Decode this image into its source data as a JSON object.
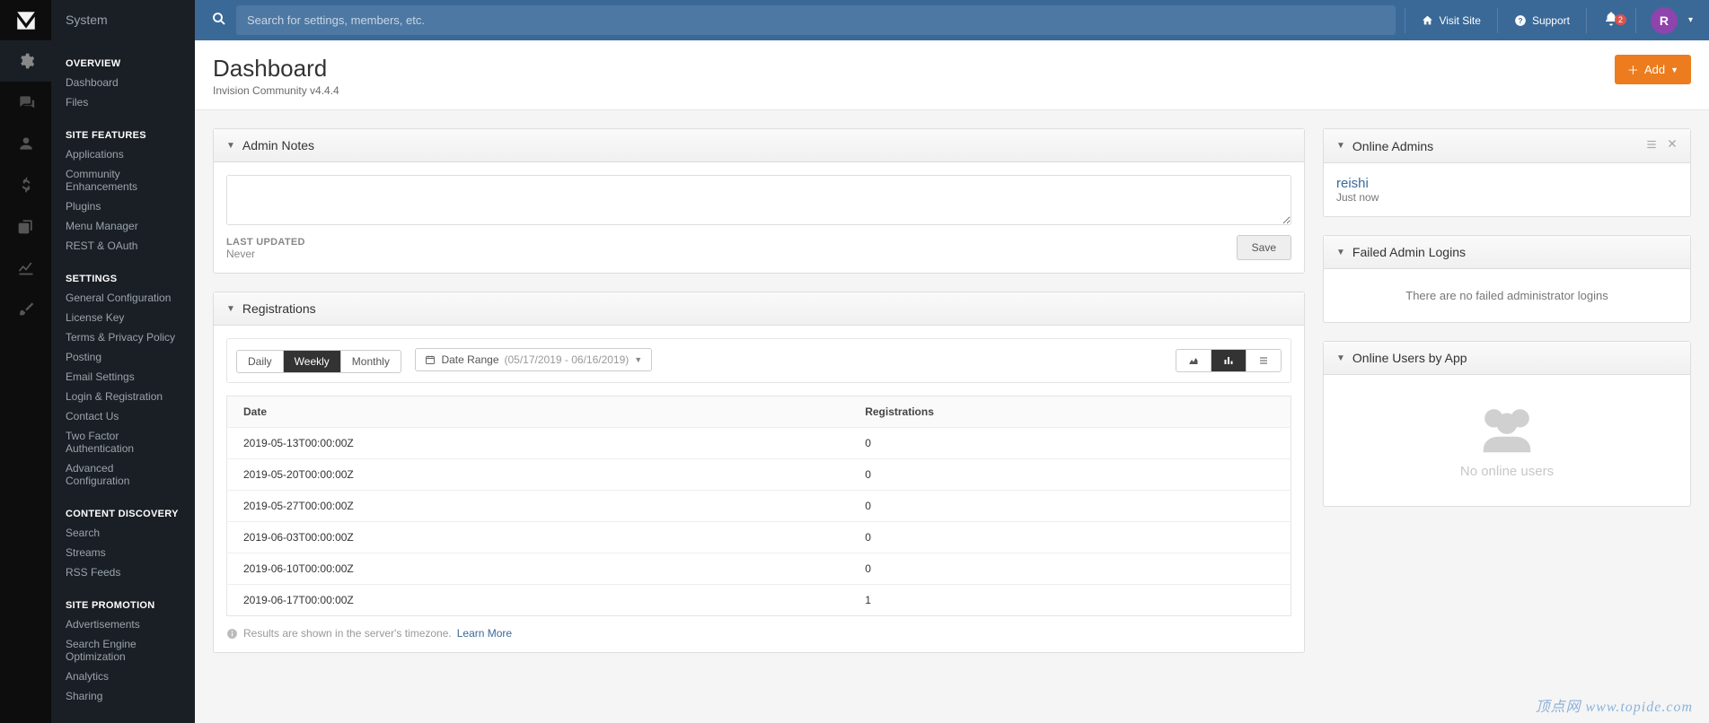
{
  "app_name": "System",
  "search": {
    "placeholder": "Search for settings, members, etc."
  },
  "topbar": {
    "visit_site": "Visit Site",
    "support": "Support",
    "notif_count": "2",
    "avatar_letter": "R"
  },
  "rail": [
    {
      "icon": "gear-icon"
    },
    {
      "icon": "comments-icon"
    },
    {
      "icon": "user-icon"
    },
    {
      "icon": "dollar-icon"
    },
    {
      "icon": "copy-icon"
    },
    {
      "icon": "chart-icon"
    },
    {
      "icon": "brush-icon"
    }
  ],
  "sidebar": [
    {
      "heading": "OVERVIEW",
      "items": [
        "Dashboard",
        "Files"
      ]
    },
    {
      "heading": "SITE FEATURES",
      "items": [
        "Applications",
        "Community Enhancements",
        "Plugins",
        "Menu Manager",
        "REST & OAuth"
      ]
    },
    {
      "heading": "SETTINGS",
      "items": [
        "General Configuration",
        "License Key",
        "Terms & Privacy Policy",
        "Posting",
        "Email Settings",
        "Login & Registration",
        "Contact Us",
        "Two Factor Authentication",
        "Advanced Configuration"
      ]
    },
    {
      "heading": "CONTENT DISCOVERY",
      "items": [
        "Search",
        "Streams",
        "RSS Feeds"
      ]
    },
    {
      "heading": "SITE PROMOTION",
      "items": [
        "Advertisements",
        "Search Engine Optimization",
        "Analytics",
        "Sharing"
      ]
    }
  ],
  "page": {
    "title": "Dashboard",
    "subtitle": "Invision Community v4.4.4",
    "add_btn": "Add"
  },
  "admin_notes": {
    "panel_title": "Admin Notes",
    "last_updated_label": "LAST UPDATED",
    "last_updated_value": "Never",
    "save_label": "Save"
  },
  "registrations": {
    "panel_title": "Registrations",
    "periods": {
      "daily": "Daily",
      "weekly": "Weekly",
      "monthly": "Monthly"
    },
    "date_range_label": "Date Range",
    "date_range_value": "(05/17/2019 - 06/16/2019)",
    "columns": {
      "date": "Date",
      "count": "Registrations"
    },
    "rows": [
      {
        "date": "2019-05-13T00:00:00Z",
        "count": "0"
      },
      {
        "date": "2019-05-20T00:00:00Z",
        "count": "0"
      },
      {
        "date": "2019-05-27T00:00:00Z",
        "count": "0"
      },
      {
        "date": "2019-06-03T00:00:00Z",
        "count": "0"
      },
      {
        "date": "2019-06-10T00:00:00Z",
        "count": "0"
      },
      {
        "date": "2019-06-17T00:00:00Z",
        "count": "1"
      }
    ],
    "footer_note": "Results are shown in the server's timezone.",
    "learn_more": "Learn More"
  },
  "online_admins": {
    "panel_title": "Online Admins",
    "entries": [
      {
        "name": "reishi",
        "time": "Just now"
      }
    ]
  },
  "failed_logins": {
    "panel_title": "Failed Admin Logins",
    "message": "There are no failed administrator logins"
  },
  "online_by_app": {
    "panel_title": "Online Users by App",
    "message": "No online users"
  },
  "watermark": "顶点网 www.topide.com"
}
